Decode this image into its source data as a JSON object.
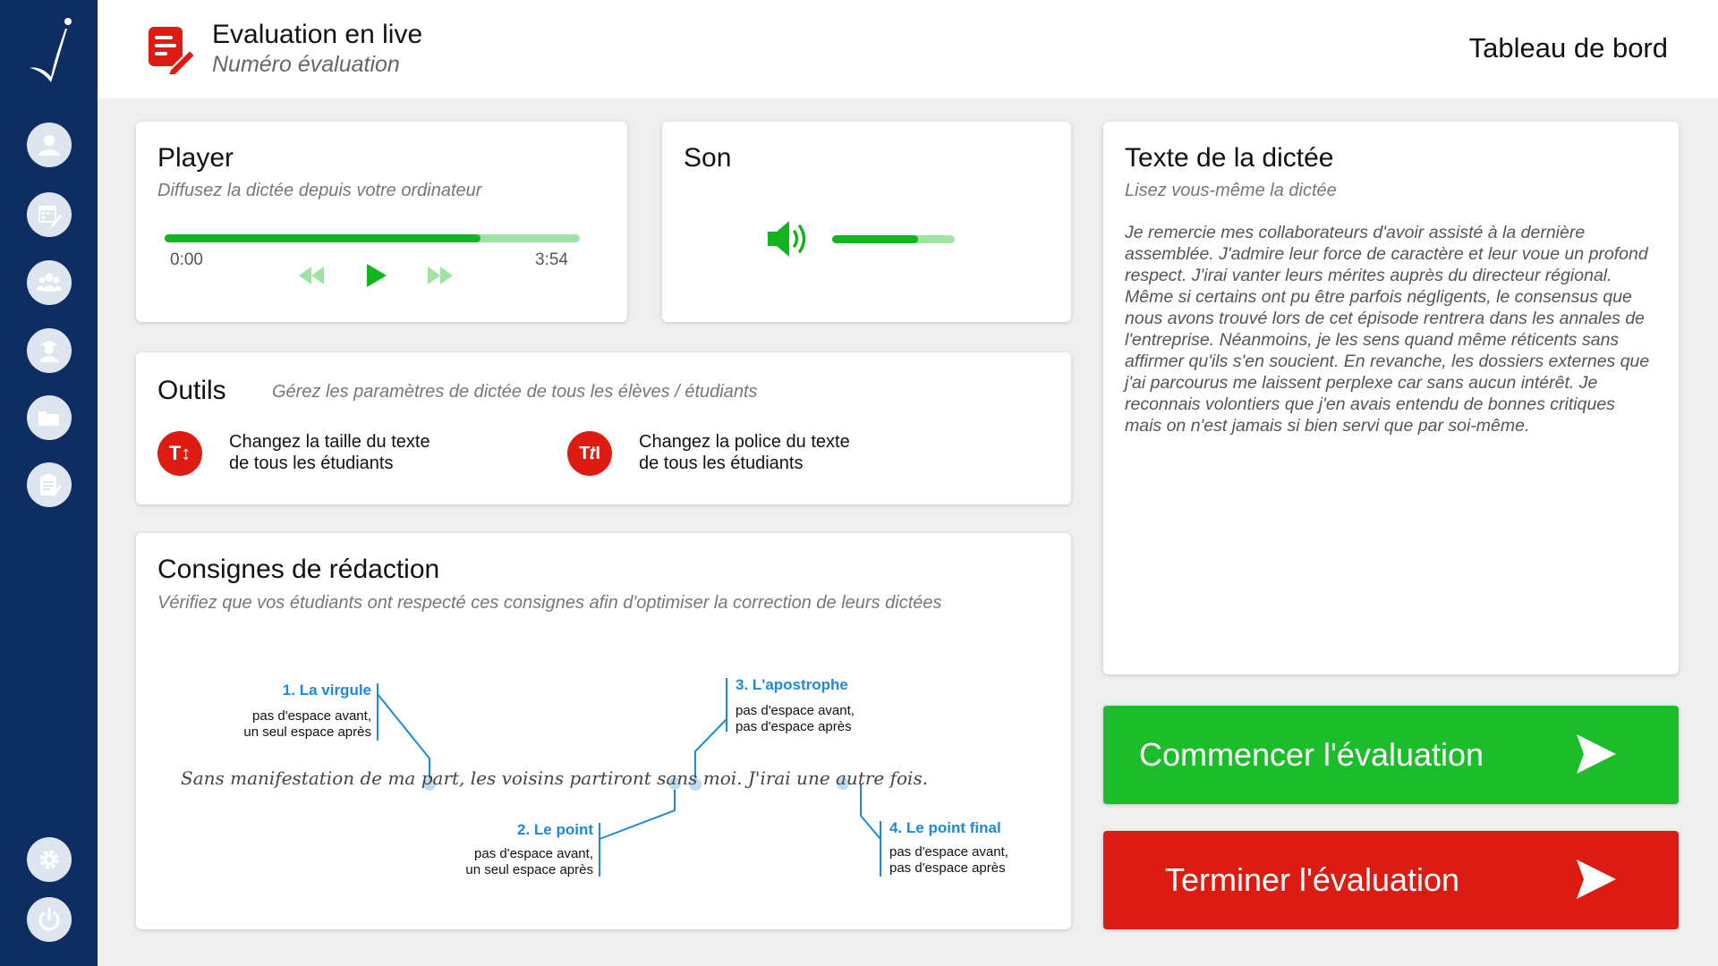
{
  "header": {
    "title": "Evaluation en live",
    "subtitle": "Numéro évaluation",
    "dashboard_link": "Tableau de bord"
  },
  "sidebar": {
    "items": [
      {
        "icon": "user-icon"
      },
      {
        "icon": "calendar-edit-icon"
      },
      {
        "icon": "group-icon"
      },
      {
        "icon": "student-icon"
      },
      {
        "icon": "folder-icon"
      },
      {
        "icon": "clipboard-icon"
      },
      {
        "icon": "gear-icon"
      },
      {
        "icon": "power-icon"
      }
    ]
  },
  "player": {
    "title": "Player",
    "subtitle": "Diffusez la dictée depuis votre ordinateur",
    "current_time": "0:00",
    "total_time": "3:54",
    "progress": 0.76
  },
  "son": {
    "title": "Son",
    "volume": 0.7
  },
  "outils": {
    "title": "Outils",
    "subtitle": "Gérez les paramètres de dictée de tous les élèves / étudiants",
    "tools": [
      {
        "icon_text": "T↕",
        "text": "Changez la taille du texte\nde tous les étudiants"
      },
      {
        "icon_text": "T𝑡I",
        "text": "Changez la police du texte\nde tous les étudiants"
      }
    ]
  },
  "consignes": {
    "title": "Consignes de rédaction",
    "subtitle": "Vérifiez que vos étudiants ont respecté ces consignes afin d'optimiser la correction de leurs dictées",
    "sentence": "Sans manifestation de ma part, les voisins partiront sans moi. J'irai une autre fois.",
    "rules": [
      {
        "label": "1. La virgule",
        "desc": "pas d'espace avant,\nun seul espace après"
      },
      {
        "label": "2. Le point",
        "desc": "pas d'espace avant,\nun seul espace après"
      },
      {
        "label": "3. L'apostrophe",
        "desc": "pas d'espace avant,\npas d'espace après"
      },
      {
        "label": "4. Le point final",
        "desc": "pas d'espace avant,\npas d'espace après"
      }
    ]
  },
  "dictee": {
    "title": "Texte de la dictée",
    "subtitle": "Lisez vous-même la dictée",
    "text": "Je remercie mes collaborateurs d'avoir assisté à la dernière assemblée. J'admire leur force de caractère et leur voue un profond respect. J'irai vanter leurs mérites auprès du directeur régional. Même si certains ont pu être parfois négligents, le consensus que nous avons trouvé lors de cet épisode rentrera dans les annales de l'entreprise. Néanmoins, je les sens quand même réticents sans affirmer qu'ils s'en soucient. En revanche, les dossiers externes que j'ai parcourus me laissent perplexe car sans aucun intérêt. Je reconnais volontiers que j'en avais entendu de bonnes critiques mais on n'est jamais si bien servi que par soi-même."
  },
  "actions": {
    "start_label": "Commencer l'évaluation",
    "end_label": "Terminer l'évaluation",
    "start_color": "#1cbd2b",
    "end_color": "#dc1c12"
  },
  "colors": {
    "sidebar": "#0d2d63",
    "accent_green": "#11b51d",
    "accent_red": "#dc1c12",
    "diagram_blue": "#1e88d9"
  }
}
